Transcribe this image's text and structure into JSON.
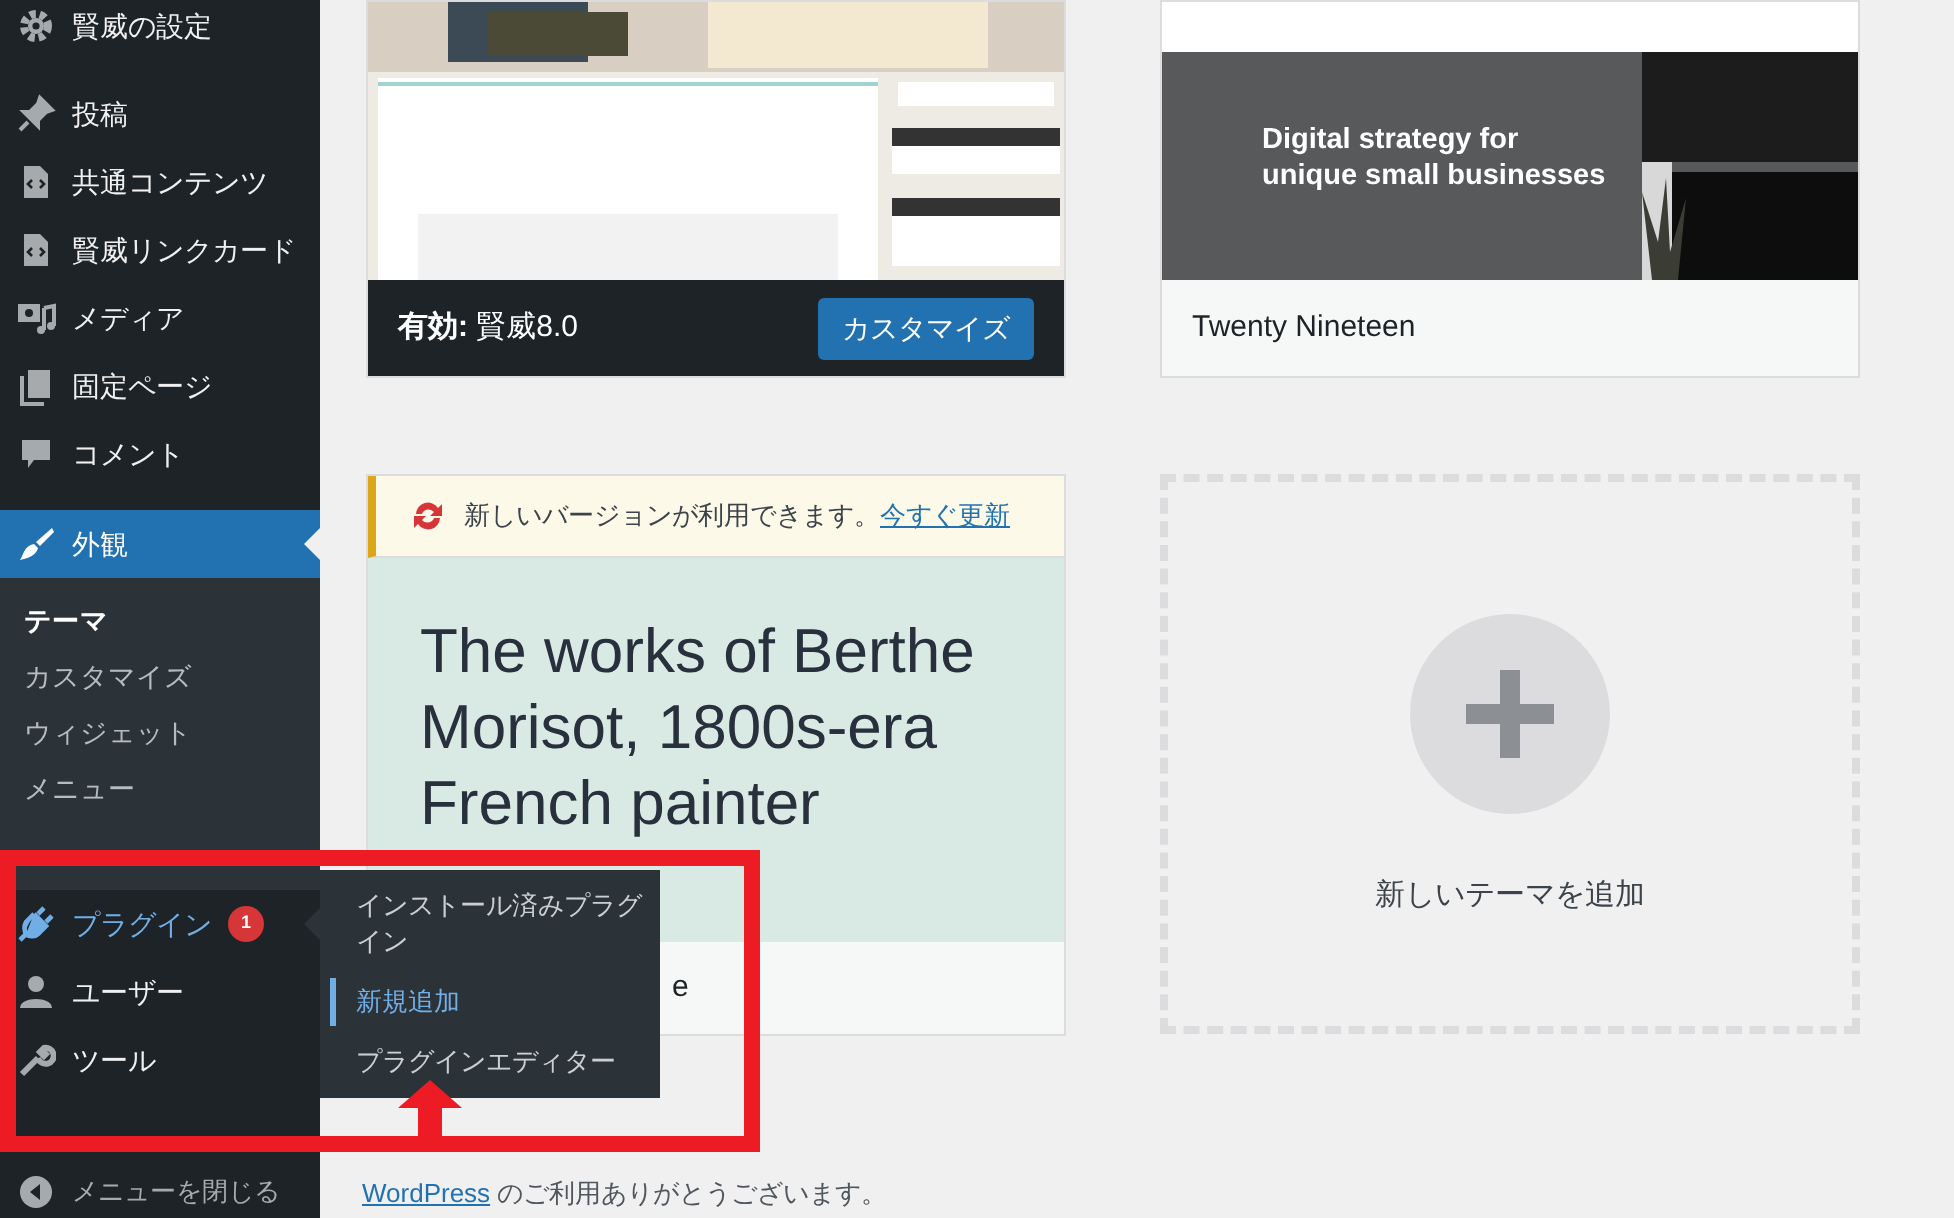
{
  "sidebar": {
    "items": [
      {
        "label": "賢威の設定",
        "selected": false
      },
      {
        "label": "投稿",
        "selected": false
      },
      {
        "label": "共通コンテンツ",
        "selected": false
      },
      {
        "label": "賢威リンクカード",
        "selected": false
      },
      {
        "label": "メディア",
        "selected": false
      },
      {
        "label": "固定ページ",
        "selected": false
      },
      {
        "label": "コメント",
        "selected": false
      },
      {
        "label": "外観",
        "selected": true,
        "children": [
          {
            "label": "テーマ",
            "selected": true
          },
          {
            "label": "カスタマイズ",
            "selected": false
          },
          {
            "label": "ウィジェット",
            "selected": false
          },
          {
            "label": "メニュー",
            "selected": false
          }
        ]
      },
      {
        "label": "プラグイン",
        "selected": false,
        "expanded": true,
        "badge": "1"
      },
      {
        "label": "ユーザー",
        "selected": false
      },
      {
        "label": "ツール",
        "selected": false
      }
    ],
    "collapse": "メニューを閉じる"
  },
  "flyout": {
    "items": [
      {
        "label": "インストール済みプラグイン",
        "selected": false
      },
      {
        "label": "新規追加",
        "selected": true
      },
      {
        "label": "プラグインエディター",
        "selected": false
      }
    ]
  },
  "themes": [
    {
      "kind": "active",
      "prefix": "有効:",
      "name": "賢威8.0",
      "button": "カスタマイズ"
    },
    {
      "kind": "theme",
      "preview": [
        "Digital strategy for",
        "unique small businesses"
      ],
      "name": "Twenty Nineteen"
    },
    {
      "kind": "update",
      "notice": "新しいバージョンが利用できます。",
      "link": "今すぐ更新",
      "preview": [
        "The works of Berthe",
        "Morisot, 1800s-era",
        "French painter"
      ],
      "name": "e"
    },
    {
      "kind": "add",
      "label": "新しいテーマを追加"
    }
  ],
  "footer": {
    "link": "WordPress",
    "text": " のご利用ありがとうございます。"
  }
}
